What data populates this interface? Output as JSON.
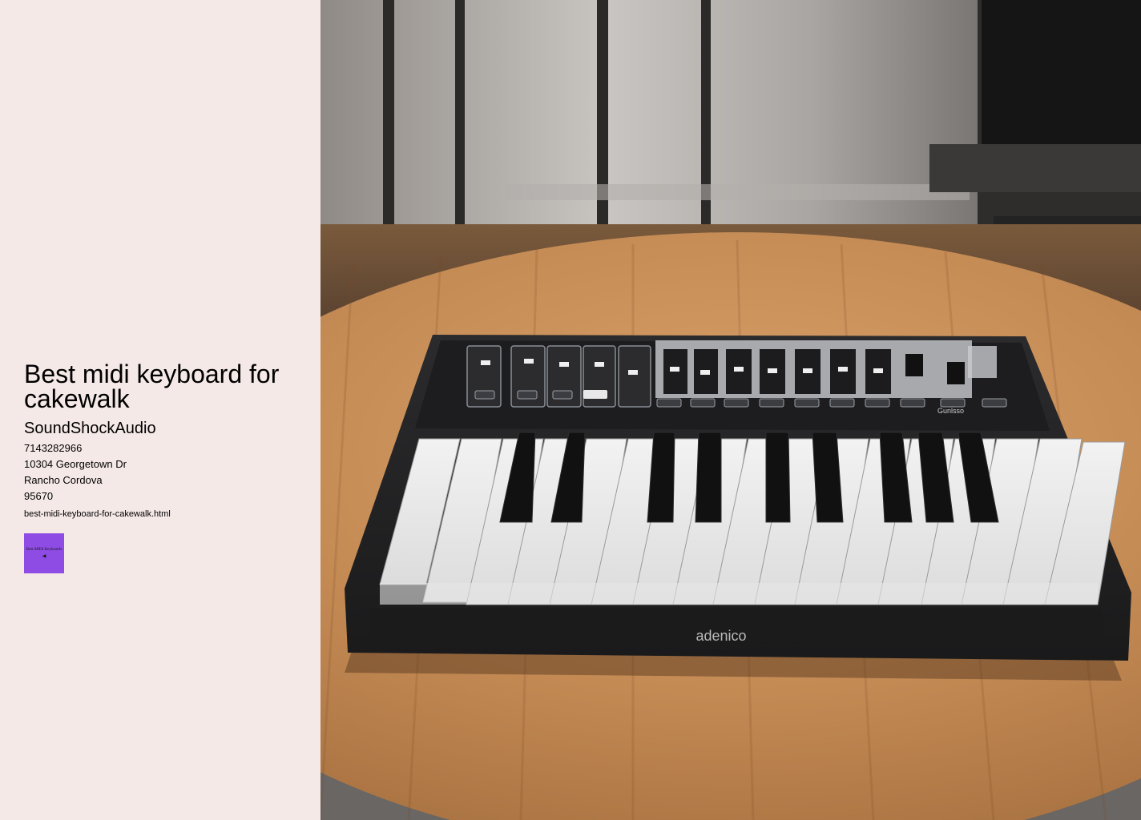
{
  "page": {
    "title": "Best midi keyboard for cakewalk",
    "company": "SoundShockAudio",
    "phone": "7143282966",
    "street": "10304 Georgetown Dr",
    "city": "Rancho Cordova",
    "zip": "95670",
    "filename": "best-midi-keyboard-for-cakewalk.html"
  },
  "thumbnail": {
    "label": "Best MIDI Keyboards",
    "icon": "speaker-icon"
  },
  "photo": {
    "brand_text": "adenico",
    "panel_text": "Gunlsso"
  },
  "colors": {
    "sidebar_bg": "#f5e9e8",
    "thumb_bg": "#8e4ce4"
  }
}
